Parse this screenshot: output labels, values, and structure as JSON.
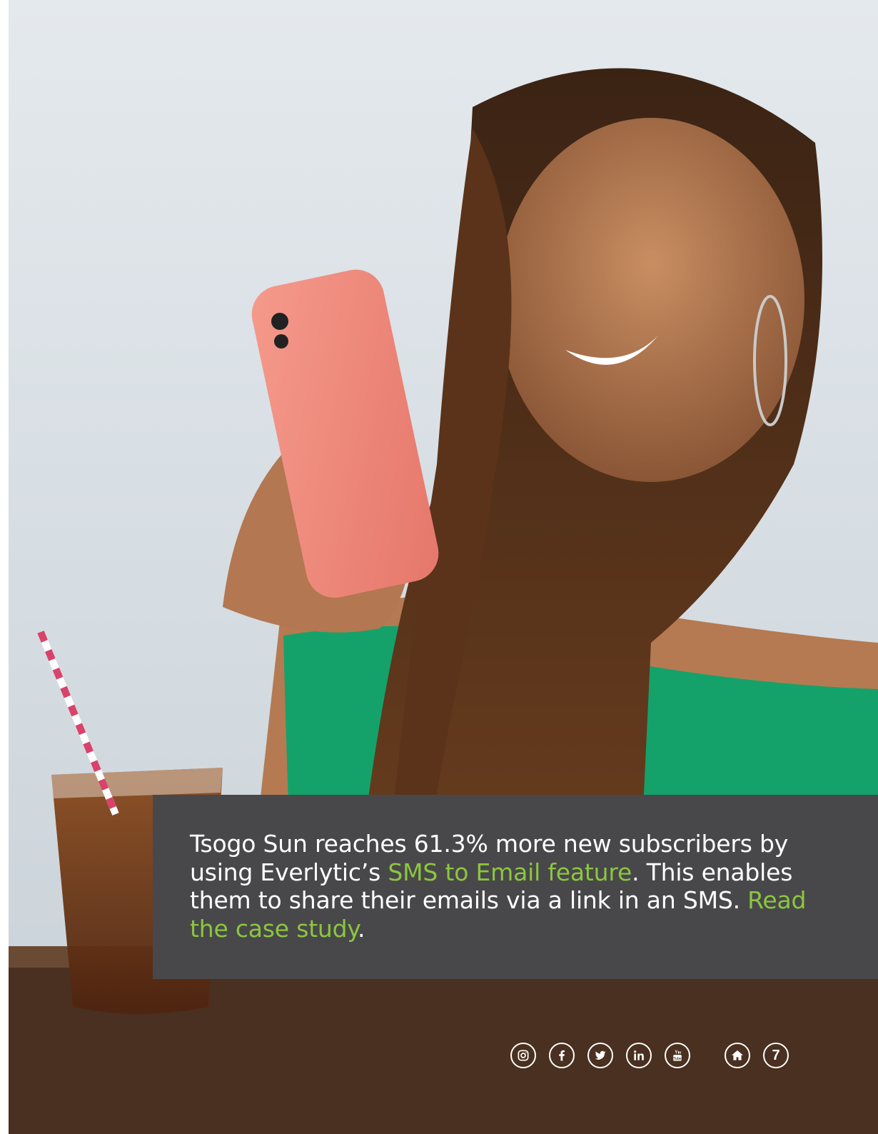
{
  "panel": {
    "line_prefix": "Tsogo Sun reaches 61.3% more new subscribers by using Everlytic’s ",
    "link_feature": "SMS to Email feature",
    "line_middle": ". This enables them to share their emails via a link in an SMS. ",
    "link_case_study": "Read the case study",
    "line_suffix": "."
  },
  "footer": {
    "icons": [
      "instagram-icon",
      "facebook-icon",
      "twitter-icon",
      "linkedin-icon",
      "youtube-icon",
      "home-icon"
    ],
    "page_number": "7"
  },
  "colors": {
    "accent": "#8cc63f",
    "panel_bg": "#48484a",
    "text": "#ffffff"
  }
}
